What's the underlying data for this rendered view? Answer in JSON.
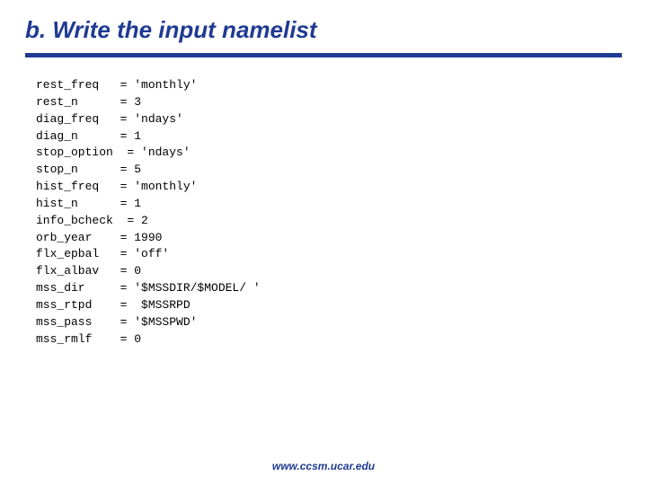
{
  "title": "b. Write the input namelist",
  "footer": "www.ccsm.ucar.edu",
  "entries": [
    {
      "key": "rest_freq",
      "value": "'monthly'"
    },
    {
      "key": "rest_n",
      "value": "3"
    },
    {
      "key": "diag_freq",
      "value": "'ndays'"
    },
    {
      "key": "diag_n",
      "value": "1"
    },
    {
      "key": "stop_option",
      "value": "'ndays'"
    },
    {
      "key": "stop_n",
      "value": "5"
    },
    {
      "key": "hist_freq",
      "value": "'monthly'"
    },
    {
      "key": "hist_n",
      "value": "1"
    },
    {
      "key": "info_bcheck",
      "value": "2"
    },
    {
      "key": "orb_year",
      "value": "1990"
    },
    {
      "key": "flx_epbal",
      "value": "'off'"
    },
    {
      "key": "flx_albav",
      "value": "0"
    },
    {
      "key": "mss_dir",
      "value": "'$MSSDIR/$MODEL/ '"
    },
    {
      "key": "mss_rtpd",
      "value": " $MSSRPD"
    },
    {
      "key": "mss_pass",
      "value": "'$MSSPWD'"
    },
    {
      "key": "mss_rmlf",
      "value": "0"
    }
  ]
}
